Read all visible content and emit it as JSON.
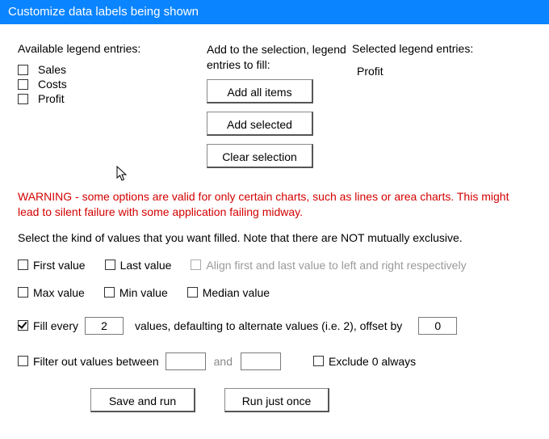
{
  "title": "Customize data labels being shown",
  "available": {
    "label": "Available legend entries:",
    "items": [
      {
        "label": "Sales",
        "checked": false
      },
      {
        "label": "Costs",
        "checked": false
      },
      {
        "label": "Profit",
        "checked": false
      }
    ]
  },
  "midInstruction": "Add to the selection, legend entries to fill:",
  "buttons": {
    "addAll": "Add all items",
    "addSelected": "Add selected",
    "clearSelection": "Clear selection",
    "saveRun": "Save and run",
    "runOnce": "Run just once"
  },
  "selected": {
    "label": "Selected legend entries:",
    "items": [
      "Profit"
    ]
  },
  "warning": "WARNING - some options are valid for only certain charts, such as lines or area charts. This might lead to silent failure with some application failing midway.",
  "instruction2": "Select the kind of values that you want filled. Note that there are NOT mutually exclusive.",
  "options": {
    "firstValue": {
      "label": "First value",
      "checked": false
    },
    "lastValue": {
      "label": "Last value",
      "checked": false
    },
    "alignFirstLast": {
      "label": "Align first and last value to left and right respectively",
      "checked": false,
      "disabled": true
    },
    "maxValue": {
      "label": "Max value",
      "checked": false
    },
    "minValue": {
      "label": "Min value",
      "checked": false
    },
    "medianValue": {
      "label": "Median value",
      "checked": false
    },
    "fillEvery": {
      "label": "Fill every",
      "checked": true,
      "value": "2",
      "suffix": "values, defaulting to alternate values (i.e. 2), offset by",
      "offset": "0"
    },
    "filterOut": {
      "label": "Filter out  values between",
      "checked": false,
      "low": "",
      "and": "and",
      "high": ""
    },
    "exclude0": {
      "label": "Exclude 0 always",
      "checked": false
    }
  }
}
